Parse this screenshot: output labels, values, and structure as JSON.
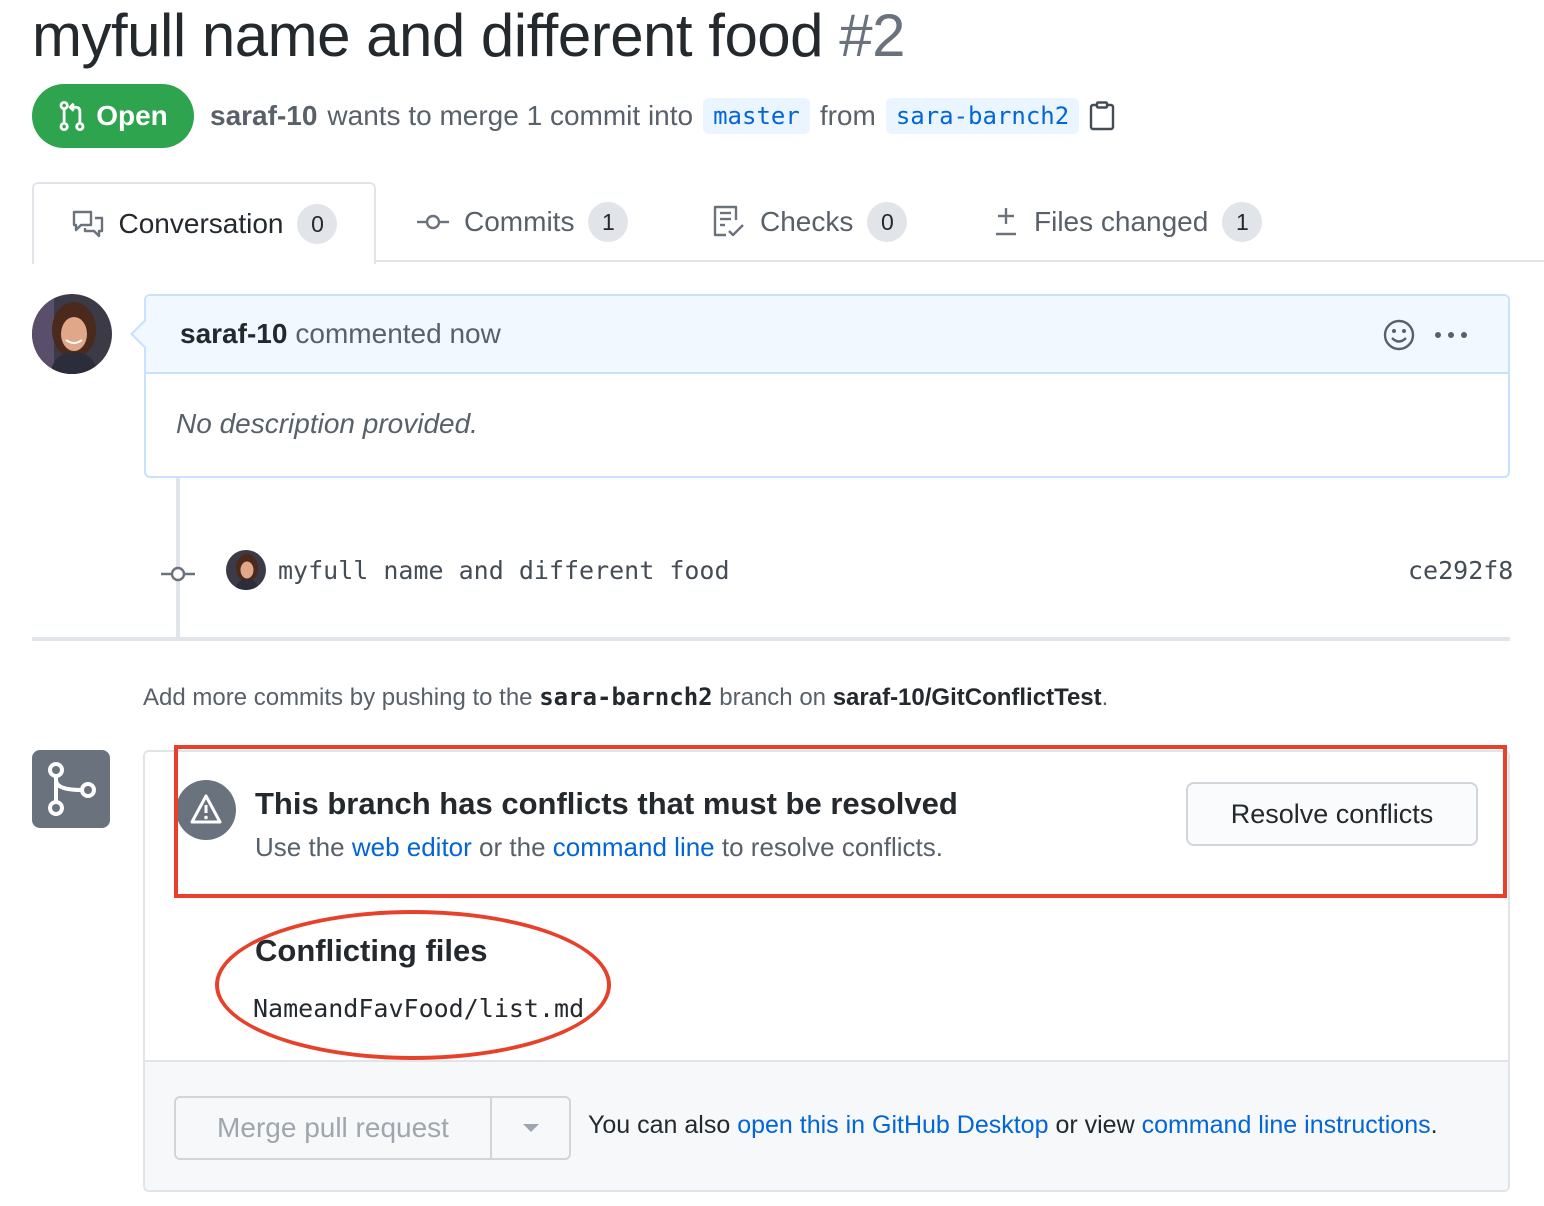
{
  "pr": {
    "title": "myfull name and different food",
    "number": "#2",
    "state": "Open",
    "author": "saraf-10",
    "merge_text": "wants to merge 1 commit into",
    "base_branch": "master",
    "from_text": "from",
    "head_branch": "sara-barnch2"
  },
  "tabs": [
    {
      "label": "Conversation",
      "count": "0",
      "icon": "comment-discussion-icon"
    },
    {
      "label": "Commits",
      "count": "1",
      "icon": "git-commit-icon"
    },
    {
      "label": "Checks",
      "count": "0",
      "icon": "checklist-icon"
    },
    {
      "label": "Files changed",
      "count": "1",
      "icon": "diff-icon"
    }
  ],
  "comment": {
    "author": "saraf-10",
    "action": "commented now",
    "body": "No description provided."
  },
  "commit": {
    "message": "myfull name and different food",
    "sha": "ce292f8"
  },
  "hint": {
    "prefix": "Add more commits by pushing to the",
    "branch": "sara-barnch2",
    "middle": "branch on",
    "repo": "saraf-10/GitConflictTest",
    "suffix": "."
  },
  "conflicts": {
    "title": "This branch has conflicts that must be resolved",
    "sub_prefix": "Use the",
    "web_editor": "web editor",
    "sub_or": "or the",
    "command_line": "command line",
    "sub_suffix": "to resolve conflicts.",
    "resolve_button": "Resolve conflicts",
    "files_title": "Conflicting files",
    "files": [
      "NameandFavFood/list.md"
    ]
  },
  "merge": {
    "button": "Merge pull request",
    "alt_prefix": "You can also",
    "desktop_link": "open this in GitHub Desktop",
    "alt_middle": "or view",
    "cli_link": "command line instructions",
    "alt_suffix": "."
  },
  "colors": {
    "open_green": "#2ea44f",
    "link_blue": "#0366d6",
    "annotation_red": "#e8412a"
  }
}
